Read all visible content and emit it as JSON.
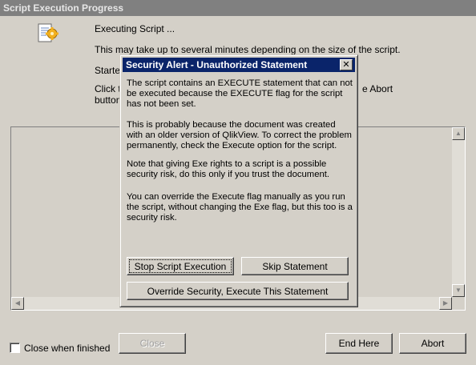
{
  "window": {
    "title": "Script Execution Progress",
    "line_executing": "Executing Script ...",
    "line_time": "This may take up to several minutes depending on the size of the script.",
    "line_started_partial": "Starte",
    "line_click_partial": "Click t",
    "line_click_right_partial": "e Abort",
    "line_button_partial": "button"
  },
  "footer": {
    "checkbox_label": "Close when finished",
    "checkbox_checked": false,
    "close_button": "Close",
    "end_here_button": "End Here",
    "abort_button": "Abort"
  },
  "dialog": {
    "title": "Security Alert - Unauthorized Statement",
    "paragraphs": [
      "The script contains an EXECUTE statement that can not be executed because the EXECUTE flag for the script has not been set.",
      "This is probably because the document was created with an older version of QlikView. To correct the problem permanently, check the Execute option for the script.",
      "Note that giving Exe rights to a script is a possible security risk, do this only if you trust the document.",
      "You can override the Execute flag manually as you run the script, without changing the Exe flag, but this too is a security risk."
    ],
    "stop_button": "Stop Script Execution",
    "skip_button": "Skip Statement",
    "override_button": "Override Security, Execute This Statement"
  },
  "icons": {
    "script": "script-gear-icon",
    "close": "close-icon"
  }
}
